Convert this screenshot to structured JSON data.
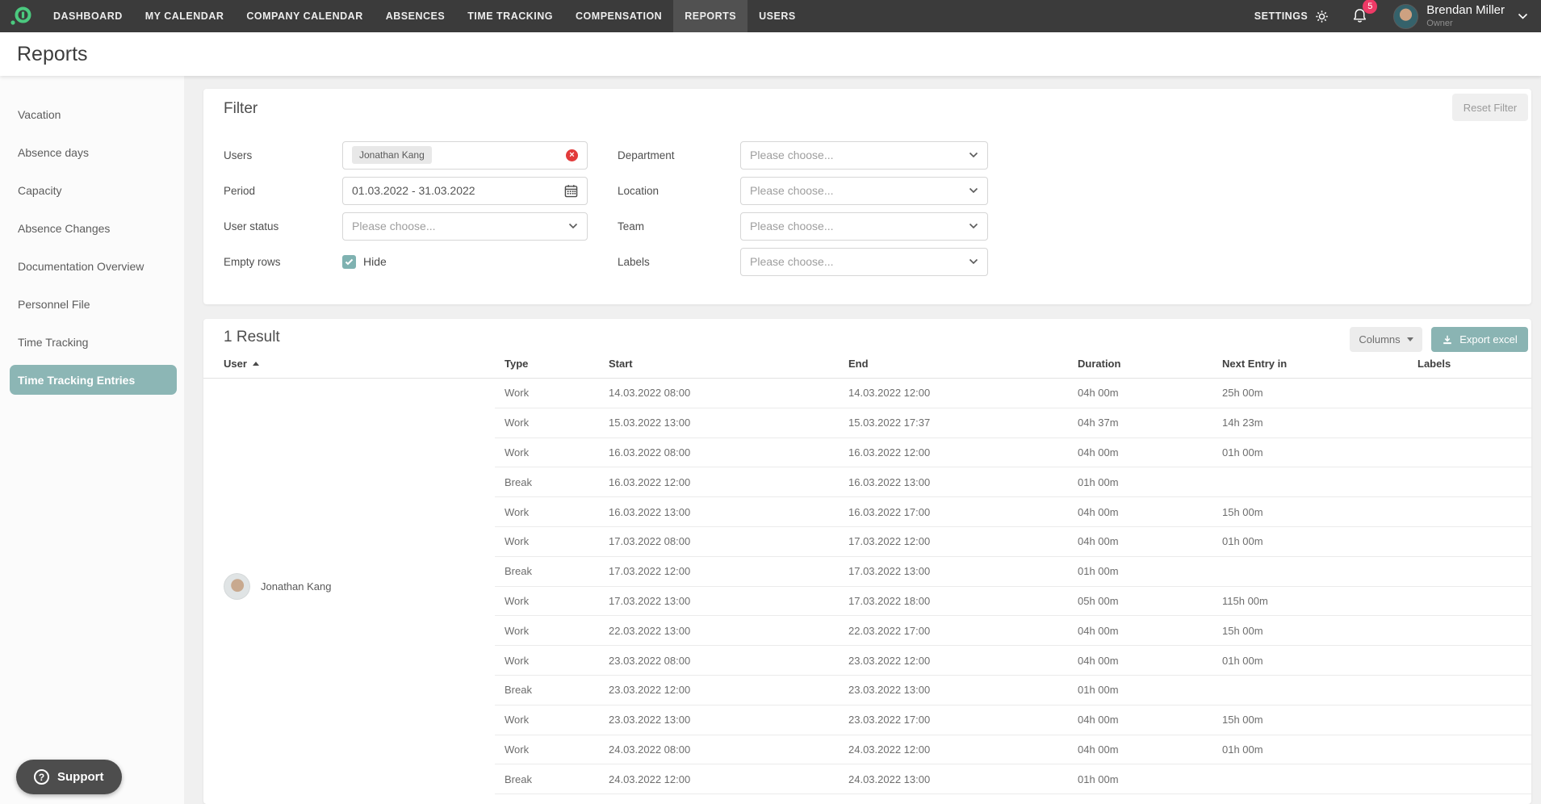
{
  "topnav": {
    "items": [
      {
        "label": "DASHBOARD",
        "active": false
      },
      {
        "label": "MY CALENDAR",
        "active": false
      },
      {
        "label": "COMPANY CALENDAR",
        "active": false
      },
      {
        "label": "ABSENCES",
        "active": false
      },
      {
        "label": "TIME TRACKING",
        "active": false
      },
      {
        "label": "COMPENSATION",
        "active": false
      },
      {
        "label": "REPORTS",
        "active": true
      },
      {
        "label": "USERS",
        "active": false
      }
    ],
    "settings_label": "SETTINGS",
    "notifications_count": "5",
    "user_name": "Brendan Miller",
    "user_role": "Owner"
  },
  "page": {
    "title": "Reports"
  },
  "sidebar": {
    "items": [
      {
        "label": "Vacation",
        "active": false
      },
      {
        "label": "Absence days",
        "active": false
      },
      {
        "label": "Capacity",
        "active": false
      },
      {
        "label": "Absence Changes",
        "active": false
      },
      {
        "label": "Documentation Overview",
        "active": false
      },
      {
        "label": "Personnel File",
        "active": false
      },
      {
        "label": "Time Tracking",
        "active": false
      },
      {
        "label": "Time Tracking Entries",
        "active": true
      }
    ]
  },
  "filter": {
    "title": "Filter",
    "reset_label": "Reset Filter",
    "fields": {
      "users": {
        "label": "Users",
        "chip": "Jonathan Kang"
      },
      "period": {
        "label": "Period",
        "value": "01.03.2022 - 31.03.2022"
      },
      "user_status": {
        "label": "User status",
        "placeholder": "Please choose..."
      },
      "empty_rows": {
        "label": "Empty rows",
        "checkbox_label": "Hide",
        "checked": true
      },
      "department": {
        "label": "Department",
        "placeholder": "Please choose..."
      },
      "location": {
        "label": "Location",
        "placeholder": "Please choose..."
      },
      "team": {
        "label": "Team",
        "placeholder": "Please choose..."
      },
      "labels": {
        "label": "Labels",
        "placeholder": "Please choose..."
      }
    }
  },
  "results": {
    "count_label": "1 Result",
    "columns_button": "Columns",
    "export_button": "Export excel",
    "table": {
      "headers": [
        "User",
        "Type",
        "Start",
        "End",
        "Duration",
        "Next Entry in",
        "Labels"
      ],
      "user": {
        "name": "Jonathan Kang"
      },
      "rows": [
        {
          "type": "Work",
          "start": "14.03.2022 08:00",
          "end": "14.03.2022 12:00",
          "duration": "04h 00m",
          "next_entry_in": "25h 00m",
          "labels": ""
        },
        {
          "type": "Work",
          "start": "15.03.2022 13:00",
          "end": "15.03.2022 17:37",
          "duration": "04h 37m",
          "next_entry_in": "14h 23m",
          "labels": ""
        },
        {
          "type": "Work",
          "start": "16.03.2022 08:00",
          "end": "16.03.2022 12:00",
          "duration": "04h 00m",
          "next_entry_in": "01h 00m",
          "labels": ""
        },
        {
          "type": "Break",
          "start": "16.03.2022 12:00",
          "end": "16.03.2022 13:00",
          "duration": "01h 00m",
          "next_entry_in": "",
          "labels": ""
        },
        {
          "type": "Work",
          "start": "16.03.2022 13:00",
          "end": "16.03.2022 17:00",
          "duration": "04h 00m",
          "next_entry_in": "15h 00m",
          "labels": ""
        },
        {
          "type": "Work",
          "start": "17.03.2022 08:00",
          "end": "17.03.2022 12:00",
          "duration": "04h 00m",
          "next_entry_in": "01h 00m",
          "labels": ""
        },
        {
          "type": "Break",
          "start": "17.03.2022 12:00",
          "end": "17.03.2022 13:00",
          "duration": "01h 00m",
          "next_entry_in": "",
          "labels": ""
        },
        {
          "type": "Work",
          "start": "17.03.2022 13:00",
          "end": "17.03.2022 18:00",
          "duration": "05h 00m",
          "next_entry_in": "115h 00m",
          "labels": ""
        },
        {
          "type": "Work",
          "start": "22.03.2022 13:00",
          "end": "22.03.2022 17:00",
          "duration": "04h 00m",
          "next_entry_in": "15h 00m",
          "labels": ""
        },
        {
          "type": "Work",
          "start": "23.03.2022 08:00",
          "end": "23.03.2022 12:00",
          "duration": "04h 00m",
          "next_entry_in": "01h 00m",
          "labels": ""
        },
        {
          "type": "Break",
          "start": "23.03.2022 12:00",
          "end": "23.03.2022 13:00",
          "duration": "01h 00m",
          "next_entry_in": "",
          "labels": ""
        },
        {
          "type": "Work",
          "start": "23.03.2022 13:00",
          "end": "23.03.2022 17:00",
          "duration": "04h 00m",
          "next_entry_in": "15h 00m",
          "labels": ""
        },
        {
          "type": "Work",
          "start": "24.03.2022 08:00",
          "end": "24.03.2022 12:00",
          "duration": "04h 00m",
          "next_entry_in": "01h 00m",
          "labels": ""
        },
        {
          "type": "Break",
          "start": "24.03.2022 12:00",
          "end": "24.03.2022 13:00",
          "duration": "01h 00m",
          "next_entry_in": "",
          "labels": ""
        }
      ]
    }
  },
  "support": {
    "label": "Support"
  },
  "colors": {
    "accent_teal": "#8ab4b3",
    "brand_green": "#4bc97f",
    "badge_pink": "#ee3a66",
    "remove_red": "#e23b3b",
    "topbar": "#3b3b3b"
  }
}
